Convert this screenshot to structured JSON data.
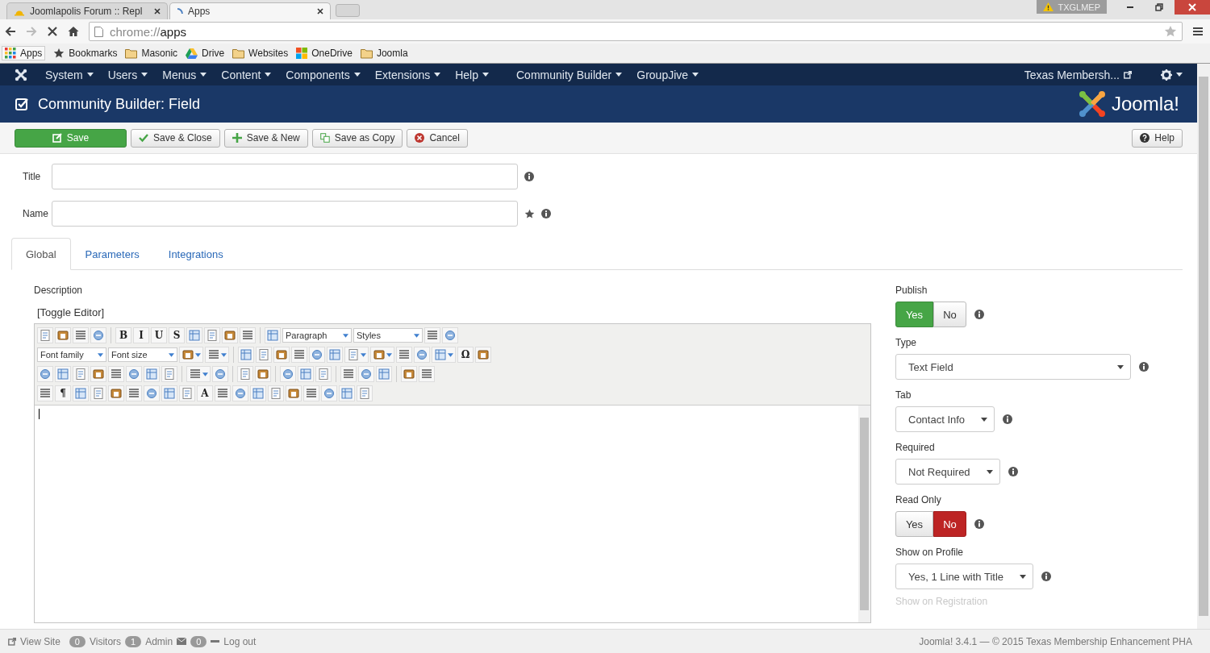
{
  "browser": {
    "tabs": [
      {
        "title": "Joomlapolis Forum :: Repl",
        "selected": false
      },
      {
        "title": "Apps",
        "selected": true
      }
    ],
    "profile": "TXGLMEP",
    "address": {
      "scheme": "chrome://",
      "host": "apps"
    },
    "bookmarks": [
      {
        "kind": "apps",
        "label": "Apps"
      },
      {
        "kind": "star",
        "label": "Bookmarks"
      },
      {
        "kind": "folder",
        "label": "Masonic"
      },
      {
        "kind": "drive",
        "label": "Drive"
      },
      {
        "kind": "folder",
        "label": "Websites"
      },
      {
        "kind": "windows",
        "label": "OneDrive"
      },
      {
        "kind": "folder",
        "label": "Joomla"
      }
    ]
  },
  "navbar": {
    "menus": [
      "System",
      "Users",
      "Menus",
      "Content",
      "Components",
      "Extensions",
      "Help",
      "Community Builder",
      "GroupJive"
    ],
    "site": "Texas Membersh..."
  },
  "header": {
    "title": "Community Builder: Field",
    "logo": "Joomla!"
  },
  "toolbar": {
    "buttons": [
      {
        "kind": "save",
        "label": "Save"
      },
      {
        "kind": "check",
        "label": "Save & Close"
      },
      {
        "kind": "plus",
        "label": "Save & New"
      },
      {
        "kind": "copy",
        "label": "Save as Copy"
      },
      {
        "kind": "cancel",
        "label": "Cancel"
      }
    ],
    "help": "Help"
  },
  "fields": [
    {
      "label": "Title",
      "required": false
    },
    {
      "label": "Name",
      "required": true
    }
  ],
  "tabs": [
    {
      "label": "Global",
      "selected": true
    },
    {
      "label": "Parameters",
      "selected": false
    },
    {
      "label": "Integrations",
      "selected": false
    }
  ],
  "editor": {
    "label": "Description",
    "toggle": "[Toggle Editor]",
    "toolbar_rows": [
      {
        "tools": [
          {
            "kind": "icon"
          },
          {
            "kind": "icon"
          },
          {
            "kind": "icon"
          },
          {
            "kind": "icon"
          },
          {
            "kind": "sep"
          },
          {
            "kind": "glyph",
            "label": "B"
          },
          {
            "kind": "glyph",
            "label": "I"
          },
          {
            "kind": "glyph",
            "label": "U"
          },
          {
            "kind": "glyph",
            "label": "S"
          },
          {
            "kind": "icon"
          },
          {
            "kind": "icon"
          },
          {
            "kind": "icon"
          },
          {
            "kind": "icon"
          },
          {
            "kind": "sep"
          },
          {
            "kind": "icon"
          },
          {
            "kind": "select",
            "value": "Paragraph"
          },
          {
            "kind": "select",
            "value": "Styles"
          },
          {
            "kind": "icon"
          },
          {
            "kind": "icon"
          }
        ]
      },
      {
        "tools": [
          {
            "kind": "select",
            "value": "Font family"
          },
          {
            "kind": "select",
            "value": "Font size"
          },
          {
            "kind": "split"
          },
          {
            "kind": "split"
          },
          {
            "kind": "sep"
          },
          {
            "kind": "icon"
          },
          {
            "kind": "icon"
          },
          {
            "kind": "icon"
          },
          {
            "kind": "icon"
          },
          {
            "kind": "icon"
          },
          {
            "kind": "icon"
          },
          {
            "kind": "split"
          },
          {
            "kind": "split"
          },
          {
            "kind": "icon"
          },
          {
            "kind": "icon"
          },
          {
            "kind": "split"
          },
          {
            "kind": "glyph",
            "label": "Ω"
          },
          {
            "kind": "icon"
          }
        ]
      },
      {
        "tools": [
          {
            "kind": "icon"
          },
          {
            "kind": "icon"
          },
          {
            "kind": "icon"
          },
          {
            "kind": "icon"
          },
          {
            "kind": "icon"
          },
          {
            "kind": "icon"
          },
          {
            "kind": "icon"
          },
          {
            "kind": "icon"
          },
          {
            "kind": "sep"
          },
          {
            "kind": "split"
          },
          {
            "kind": "icon"
          },
          {
            "kind": "sep"
          },
          {
            "kind": "icon"
          },
          {
            "kind": "icon"
          },
          {
            "kind": "sep"
          },
          {
            "kind": "icon"
          },
          {
            "kind": "icon"
          },
          {
            "kind": "icon"
          },
          {
            "kind": "sep"
          },
          {
            "kind": "icon"
          },
          {
            "kind": "icon"
          },
          {
            "kind": "icon"
          },
          {
            "kind": "sep"
          },
          {
            "kind": "icon"
          },
          {
            "kind": "icon"
          }
        ]
      },
      {
        "tools": [
          {
            "kind": "icon"
          },
          {
            "kind": "glyph",
            "label": "¶"
          },
          {
            "kind": "icon"
          },
          {
            "kind": "icon"
          },
          {
            "kind": "icon"
          },
          {
            "kind": "icon"
          },
          {
            "kind": "icon"
          },
          {
            "kind": "icon"
          },
          {
            "kind": "icon"
          },
          {
            "kind": "glyph",
            "label": "A"
          },
          {
            "kind": "icon"
          },
          {
            "kind": "icon"
          },
          {
            "kind": "icon"
          },
          {
            "kind": "icon"
          },
          {
            "kind": "icon"
          },
          {
            "kind": "icon"
          },
          {
            "kind": "icon"
          },
          {
            "kind": "icon"
          },
          {
            "kind": "icon"
          }
        ]
      }
    ]
  },
  "options": [
    {
      "kind": "toggle",
      "label": "Publish",
      "choices": [
        {
          "label": "Yes",
          "selected": true
        },
        {
          "label": "No",
          "selected": false
        }
      ]
    },
    {
      "kind": "select",
      "label": "Type",
      "value": "Text Field",
      "wide": true
    },
    {
      "kind": "select",
      "label": "Tab",
      "value": "Contact Info",
      "wide": false
    },
    {
      "kind": "select",
      "label": "Required",
      "value": "Not Required",
      "wide": false
    },
    {
      "kind": "toggle",
      "label": "Read Only",
      "choices": [
        {
          "label": "Yes",
          "selected": false
        },
        {
          "label": "No",
          "selected": true
        }
      ]
    },
    {
      "kind": "select",
      "label": "Show on Profile",
      "value": "Yes, 1 Line with Title",
      "wide": false
    },
    {
      "kind": "heading",
      "label": "Show on Registration"
    }
  ],
  "footer": {
    "view_site": "View Site",
    "visitors": "0",
    "visitors_label": "Visitors",
    "admins": "1",
    "admins_label": "Admin",
    "messages": "0",
    "logout": "Log out",
    "copyright": "Joomla! 3.4.1 — © 2015 Texas Membership Enhancement PHA"
  }
}
